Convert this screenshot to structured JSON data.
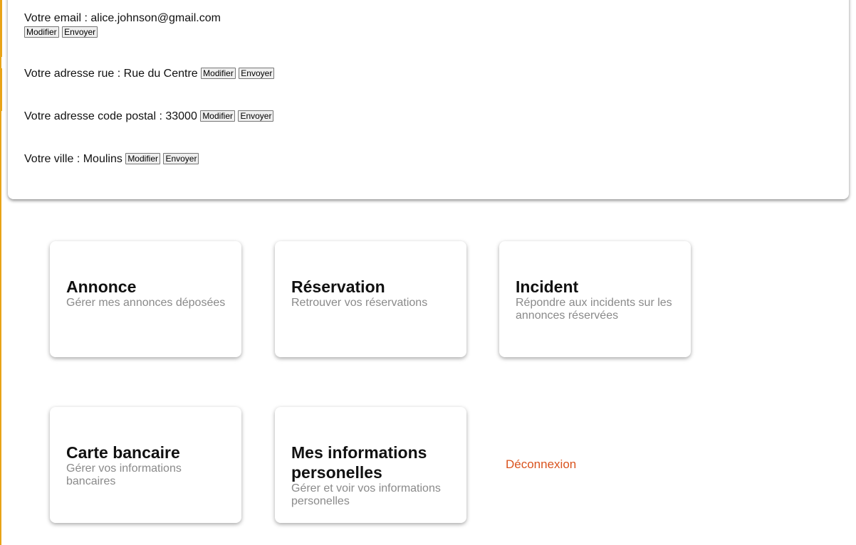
{
  "profile": {
    "email": {
      "label": "Votre email :",
      "value": "alice.johnson@gmail.com"
    },
    "street": {
      "label": "Votre adresse rue :",
      "value": "Rue du Centre"
    },
    "zip": {
      "label": "Votre adresse code postal :",
      "value": "33000"
    },
    "city": {
      "label": "Votre ville :",
      "value": "Moulins"
    },
    "edit_label": "Modifier",
    "send_label": "Envoyer"
  },
  "cards": [
    {
      "title": "Annonce",
      "desc": "Gérer mes annonces déposées"
    },
    {
      "title": "Réservation",
      "desc": "Retrouver vos réservations"
    },
    {
      "title": "Incident",
      "desc": "Répondre aux incidents sur les annonces réservées"
    },
    {
      "title": "Carte bancaire",
      "desc": "Gérer vos informations bancaires"
    },
    {
      "title": "Mes informations personelles",
      "desc": "Gérer et voir vos informations personelles"
    }
  ],
  "logout_label": "Déconnexion",
  "colors": {
    "accent": "#e8a317",
    "logout": "#d9531e",
    "muted": "#8a8a8a"
  }
}
